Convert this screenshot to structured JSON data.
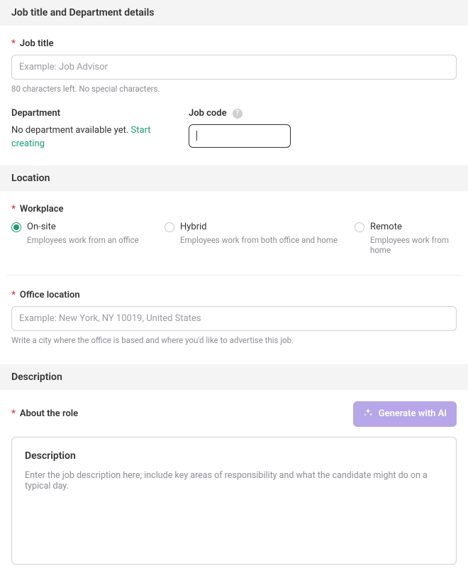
{
  "sections": {
    "job_title_dept": {
      "header": "Job title and Department details",
      "job_title": {
        "label": "Job title",
        "placeholder": "Example: Job Advisor",
        "value": "",
        "helper": "80 characters left. No special characters."
      },
      "department": {
        "label": "Department",
        "text_prefix": "No department available yet. ",
        "link_text": "Start creating"
      },
      "job_code": {
        "label": "Job code",
        "value": ""
      }
    },
    "location": {
      "header": "Location",
      "workplace": {
        "label": "Workplace",
        "options": [
          {
            "label": "On-site",
            "desc": "Employees work from an office",
            "selected": true
          },
          {
            "label": "Hybrid",
            "desc": "Employees work from both office and home",
            "selected": false
          },
          {
            "label": "Remote",
            "desc": "Employees work from home",
            "selected": false
          }
        ]
      },
      "office_location": {
        "label": "Office location",
        "placeholder": "Example: New York, NY 10019, United States",
        "value": "",
        "helper": "Write a city where the office is based and where you'd like to advertise this job."
      }
    },
    "description": {
      "header": "Description",
      "about_label": "About the role",
      "generate_btn": "Generate with AI",
      "box_heading": "Description",
      "box_placeholder": "Enter the job description here; include key areas of responsibility and what the candidate might do on a typical day."
    }
  }
}
